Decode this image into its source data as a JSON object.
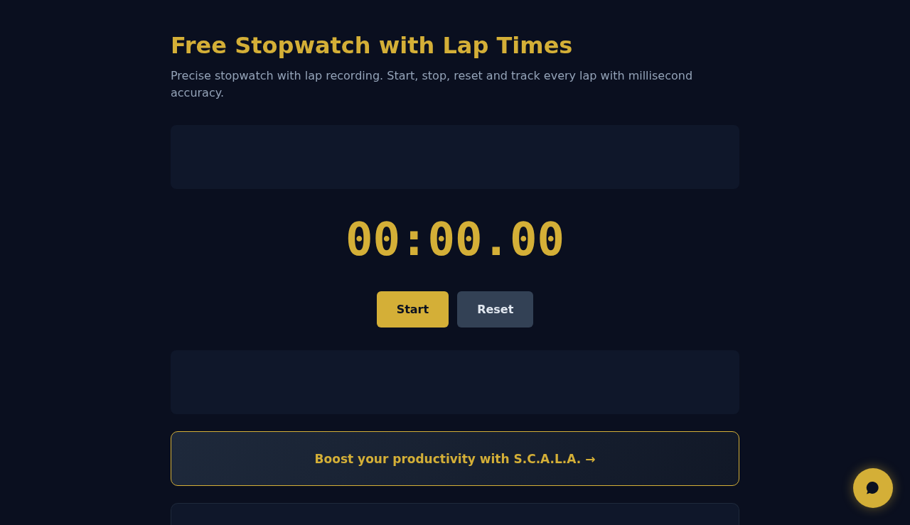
{
  "title": "Free Stopwatch with Lap Times",
  "subtitle": "Precise stopwatch with lap recording. Start, stop, reset and track every lap with millisecond accuracy.",
  "timer": {
    "display": "00:00.00"
  },
  "buttons": [
    {
      "label": "Start",
      "kind": "primary"
    },
    {
      "label": "Reset",
      "kind": "secondary"
    }
  ],
  "promo": {
    "label": "Boost your productivity with S.C.A.L.A. →"
  }
}
